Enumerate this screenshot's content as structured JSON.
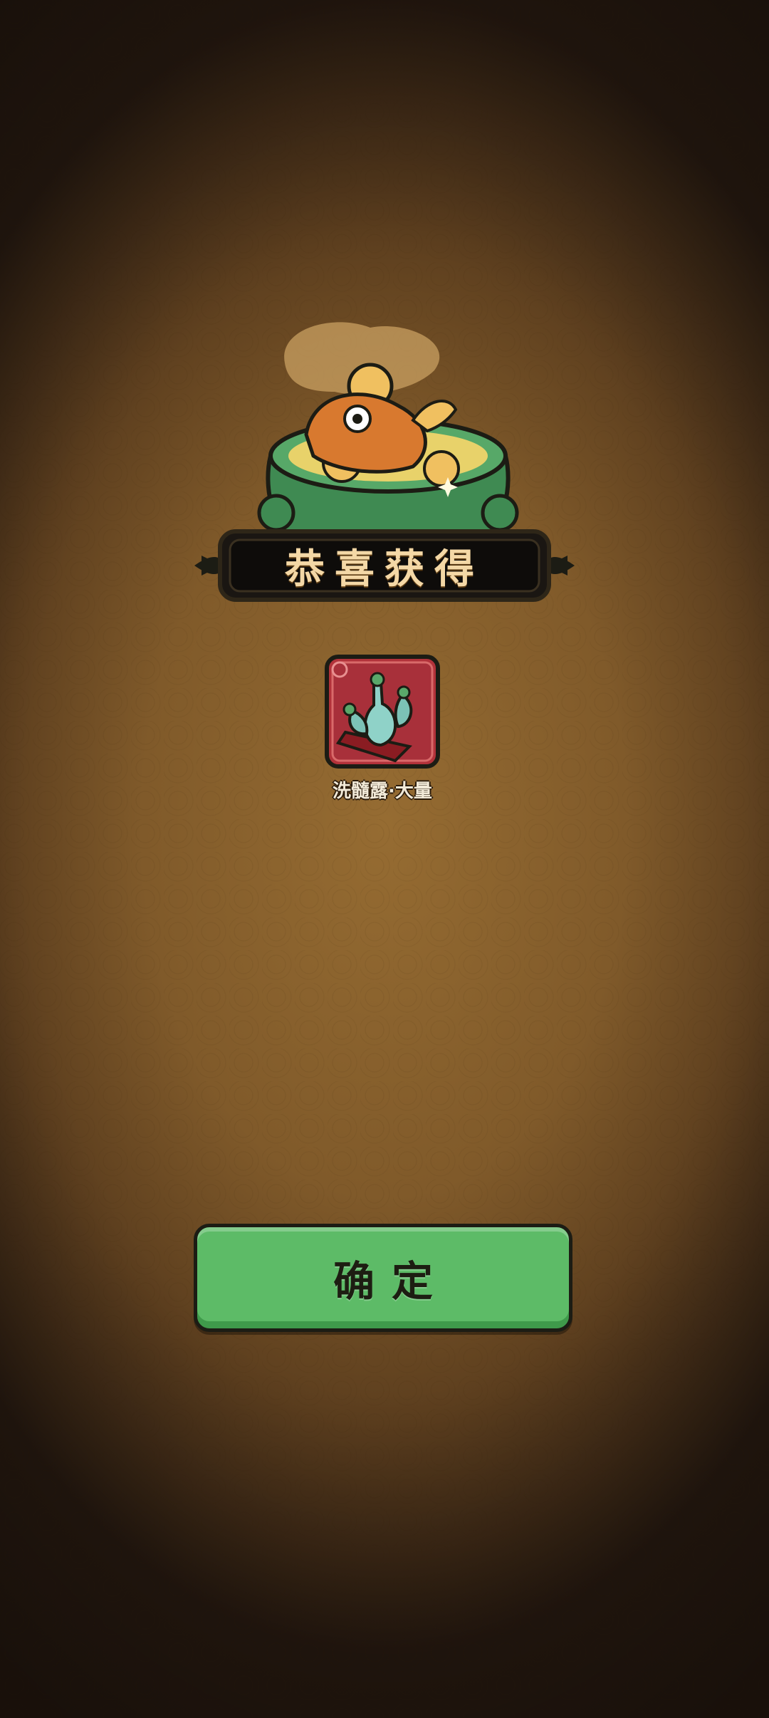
{
  "dialog": {
    "title": "恭喜获得",
    "reward": {
      "name": "洗髓露·大量",
      "icon": "potion-bottles-icon"
    },
    "confirm_label": "确定"
  },
  "colors": {
    "button_green": "#5dbb67",
    "banner_text": "#f4d8a6",
    "background": "#8a6230"
  }
}
